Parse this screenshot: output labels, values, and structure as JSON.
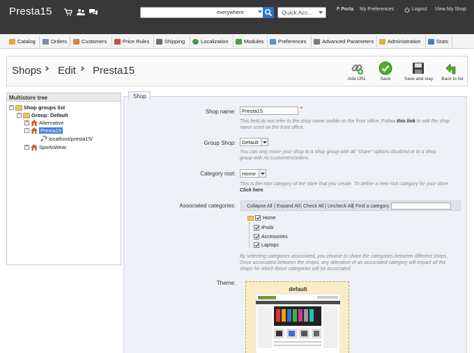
{
  "header": {
    "brand": "Presta15",
    "icons": [
      "cart-icon",
      "users-icon",
      "messages-icon"
    ],
    "search": {
      "value": "",
      "placeholder": "",
      "scope": "everywhere"
    },
    "quick_access": "Quick Acc...",
    "user_name": "F Porta",
    "my_preferences": "My Preferences",
    "logout": "Logout",
    "view_my_shop": "View My Shop"
  },
  "menu": [
    {
      "label": "Catalog",
      "icon": "catalog-icon",
      "color": "#e5a33a"
    },
    {
      "label": "Orders",
      "icon": "orders-icon",
      "color": "#7a8ca3"
    },
    {
      "label": "Customers",
      "icon": "customers-icon",
      "color": "#d9853b"
    },
    {
      "label": "Price Rules",
      "icon": "price-rules-icon",
      "color": "#c44b4b"
    },
    {
      "label": "Shipping",
      "icon": "shipping-icon",
      "color": "#6d6d6d"
    },
    {
      "label": "Localization",
      "icon": "localization-icon",
      "color": "#3d9b54"
    },
    {
      "label": "Modules",
      "icon": "modules-icon",
      "color": "#47a145"
    },
    {
      "label": "Preferences",
      "icon": "preferences-icon",
      "color": "#5e8fc7"
    },
    {
      "label": "Advanced Parameters",
      "icon": "advanced-parameters-icon",
      "color": "#7a7a7a"
    },
    {
      "label": "Administration",
      "icon": "administration-icon",
      "color": "#d6b53a"
    },
    {
      "label": "Stats",
      "icon": "stats-icon",
      "color": "#4a7bc2"
    }
  ],
  "toolbar": {
    "breadcrumb": [
      "Shops",
      "Edit",
      "Presta15"
    ],
    "buttons": [
      {
        "label": "Add URL",
        "icon": "add-url-icon"
      },
      {
        "label": "Save",
        "icon": "save-check-icon"
      },
      {
        "label": "Save and stay",
        "icon": "floppy-disk-icon"
      },
      {
        "label": "Back to list",
        "icon": "back-arrow-icon"
      }
    ]
  },
  "tree": {
    "title": "Multistore tree",
    "root": "Shop groups list",
    "group": "Group: Default",
    "shops": [
      "Alternative",
      "Presta15",
      "SportsWear"
    ],
    "url": "localhost/presta15/"
  },
  "form": {
    "tab": "Shop",
    "shop_name": {
      "label": "Shop name:",
      "value": "Presta15",
      "required": "*",
      "hint_before": "This field do not refer to the shop name visible on the front office. Follow",
      "hint_link": "this link",
      "hint_after": "to edit the shop name used on the front office."
    },
    "group_shop": {
      "label": "Group Shop:",
      "value": "Default",
      "hint": "You can only move your shop to a shop group with all \"share\" options disabled or to a shop group with no customers/orders."
    },
    "category_root": {
      "label": "Category root:",
      "value": "Home",
      "hint_before": "This is the root category of the store that you create. To define a new root category for your store",
      "hint_link": "Click here"
    },
    "associated_categories": {
      "label": "Associated categories:",
      "actions": [
        "Collapse All",
        "Expand All",
        "Check All",
        "Uncheck All"
      ],
      "find_label": "Find a category :",
      "find_value": "",
      "root": "Home",
      "children": [
        "iPods",
        "Accessories",
        "Laptops"
      ],
      "hint": "By selecting categories associated, you choose to share the categories between different shops. Once associated between the shops, any alteration of an associated category will impact all the shops for which those categories will be associated."
    },
    "theme": {
      "label": "Theme:",
      "name": "default"
    }
  }
}
